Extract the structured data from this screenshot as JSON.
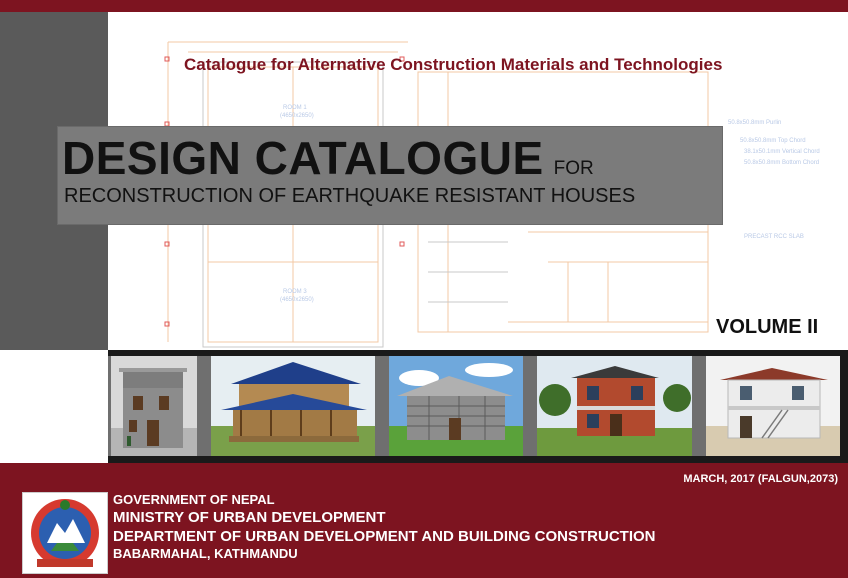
{
  "cover": {
    "subtitle": "Catalogue for Alternative Construction Materials and Technologies",
    "title_main": "DESIGN CATALOGUE",
    "title_for": "FOR",
    "title_line2": "RECONSTRUCTION OF EARTHQUAKE RESISTANT HOUSES",
    "volume": "VOLUME II"
  },
  "blueprint_labels": {
    "room_a": "ROOM 1",
    "room_a_dim": "(4650x2650)",
    "room_b": "ROOM 3",
    "room_b_dim": "(4650x2650)",
    "purlin": "50.8x50.8mm Purlin",
    "top_chord": "50.8x50.8mm Top Chord",
    "vertical_chord": "38.1x50.1mm Vertical Chord",
    "bottom_chord": "50.8x50.8mm Bottom Chord",
    "slab": "PRECAST RCC SLAB"
  },
  "photos": [
    {
      "name": "stone-masonry-tower-house"
    },
    {
      "name": "timber-frame-house"
    },
    {
      "name": "cement-block-house"
    },
    {
      "name": "brick-two-storey-house"
    },
    {
      "name": "white-two-storey-house"
    }
  ],
  "footer": {
    "date": "MARCH, 2017 (FALGUN,2073)",
    "line1": "GOVERNMENT OF NEPAL",
    "line2": "MINISTRY OF URBAN DEVELOPMENT",
    "line3": "DEPARTMENT OF URBAN DEVELOPMENT AND BUILDING CONSTRUCTION",
    "line4": "BABARMAHAL, KATHMANDU",
    "emblem_icon": "nepal-government-emblem"
  },
  "colors": {
    "maroon": "#7d1420",
    "side_gray": "#5a5a5a",
    "title_box_gray": "#7b7b7b"
  }
}
